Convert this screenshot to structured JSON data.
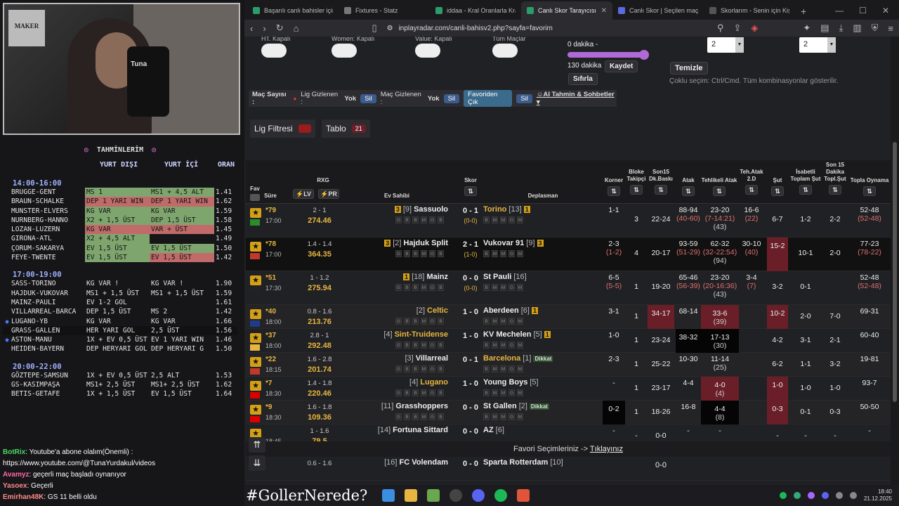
{
  "webcam": {
    "poster_text": "MAKER",
    "chair_text": "Tuna"
  },
  "picks": {
    "title": "TAHMİNLERİM",
    "col_abroad": "YURT DIŞI",
    "col_domestic": "YURT İÇİ",
    "col_odds": "ORAN",
    "groups": [
      {
        "time": "14:00-16:00",
        "rows": [
          {
            "m": "BRUGGE-GENT",
            "p1": "MS 1",
            "p2": "MS1 + 4,5 ALT",
            "o": "1.41",
            "c1": "g",
            "c2": "g",
            "dot": false
          },
          {
            "m": "BRAUN-SCHALKE",
            "p1": "DEP 1 YARI WIN",
            "p2": "DEP 1 YARI WIN",
            "o": "1.62",
            "c1": "r",
            "c2": "r",
            "dot": false
          },
          {
            "m": "MUNSTER-ELVERS",
            "p1": "KG VAR",
            "p2": "KG VAR",
            "o": "1.59",
            "c1": "g",
            "c2": "g",
            "dot": false
          },
          {
            "m": "NURNBERG-HANNO",
            "p1": "X2 + 1,5 ÜST",
            "p2": "DEP 1,5 ÜST",
            "o": "1.58",
            "c1": "g",
            "c2": "g",
            "dot": false
          },
          {
            "m": "LOZAN-LUZERN",
            "p1": "KG VAR",
            "p2": "VAR + ÜST",
            "o": "1.45",
            "c1": "r",
            "c2": "r",
            "dot": false
          },
          {
            "m": "GIRONA-ATL",
            "p1": "X2 + 4,5 ALT",
            "p2": "",
            "o": "1.49",
            "c1": "g",
            "c2": "n",
            "dot": false
          },
          {
            "m": "ÇORUM-SAKARYA",
            "p1": "EV 1,5 ÜST",
            "p2": "EV 1,5 ÜST",
            "o": "1.50",
            "c1": "g",
            "c2": "g",
            "dot": false
          },
          {
            "m": "FEYE-TWENTE",
            "p1": "EV 1,5 ÜST",
            "p2": "EV 1,5 ÜST",
            "o": "1.42",
            "c1": "g",
            "c2": "r",
            "dot": false
          }
        ]
      },
      {
        "time": "17:00-19:00",
        "rows": [
          {
            "m": "SASS-TORINO",
            "p1": "KG VAR  !",
            "p2": "KG VAR  !",
            "o": "1.90",
            "c1": "n",
            "c2": "n",
            "dot": false
          },
          {
            "m": "HAJDUK-VUKOVAR",
            "p1": "MS1 + 1,5 ÜST",
            "p2": "MS1 + 1,5 ÜST",
            "o": "1.59",
            "c1": "n",
            "c2": "n",
            "dot": false
          },
          {
            "m": "MAINZ-PAULI",
            "p1": "EV 1-2 GOL",
            "p2": "",
            "o": "1.61",
            "c1": "n",
            "c2": "n",
            "dot": false
          },
          {
            "m": "VILLARREAL-BARCA",
            "p1": "DEP 1,5 ÜST",
            "p2": "MS 2",
            "o": "1.42",
            "c1": "n",
            "c2": "n",
            "dot": false
          },
          {
            "m": "LUGANO-YB",
            "p1": "KG VAR",
            "p2": "KG VAR",
            "o": "1.66",
            "c1": "n",
            "c2": "n",
            "dot": true
          },
          {
            "m": "GRASS-GALLEN",
            "p1": "HER YARI GOL",
            "p2": "2,5 ÜST",
            "o": "1.56",
            "c1": "n",
            "c2": "n",
            "dot": false,
            "hl": true
          },
          {
            "m": "ASTON-MANU",
            "p1": "1X + EV 0,5 ÜST",
            "p2": "EV 1 YARI WIN",
            "o": "1.46",
            "c1": "n",
            "c2": "n",
            "dot": true
          },
          {
            "m": "HEIDEN-BAYERN",
            "p1": "DEP HERYARI GOL",
            "p2": "DEP HERYARI G",
            "o": "1.50",
            "c1": "n",
            "c2": "n",
            "dot": false
          }
        ]
      },
      {
        "time": "20:00-22:00",
        "rows": [
          {
            "m": "GÖZTEPE-SAMSUN",
            "p1": "1X + EV 0,5 ÜST",
            "p2": "2,5 ALT",
            "o": "1.53",
            "c1": "n",
            "c2": "n",
            "dot": false
          },
          {
            "m": "GS-KASIMPAŞA",
            "p1": "MS1+ 2,5 ÜST",
            "p2": "MS1+ 2,5 ÜST",
            "o": "1.62",
            "c1": "n",
            "c2": "n",
            "dot": false
          },
          {
            "m": "BETIS-GETAFE",
            "p1": "1X + 1,5 ÜST",
            "p2": "EV 1,5 ÜST",
            "o": "1.64",
            "c1": "n",
            "c2": "n",
            "dot": false
          }
        ]
      }
    ]
  },
  "chat": [
    {
      "name": "BotRix",
      "text": ": Youtube'a abone olalım(Önemli) :",
      "cls": "nm1"
    },
    {
      "name": "",
      "text": "https://www.youtube.com/@TunaYurdakul/videos",
      "cls": ""
    },
    {
      "name": "Avamyz",
      "text": ": geçerli maç başladı oynanıyor",
      "cls": "nm2"
    },
    {
      "name": "Yasoex",
      "text": ": Geçerli",
      "cls": "nm3"
    },
    {
      "name": "Emirhan48K",
      "text": ": GS 11 belli oldu",
      "cls": "nm3"
    }
  ],
  "browser": {
    "tabs": [
      {
        "label": "Başarılı canlı bahisler için Oy",
        "active": false,
        "color": "#2a9d6a"
      },
      {
        "label": "Fixtures - Statz",
        "active": false,
        "color": "#777"
      },
      {
        "label": "iddaa - Kral Oranlarla Kralı",
        "active": false,
        "color": "#2a9d6a"
      },
      {
        "label": "Canlı Skor Tarayıcısı ve",
        "active": true,
        "color": "#2a9d6a"
      },
      {
        "label": "Canlı Skor | Seçilen maçlar",
        "active": false,
        "color": "#5a6adf"
      },
      {
        "label": "Skorlarım - Senin için Kişise",
        "active": false,
        "color": "#555"
      }
    ],
    "url": "inplayradar.com/canli-bahisv2.php?sayfa=favorim"
  },
  "controls": {
    "toggle_labels": [
      "HT. Kapalı",
      "Women: Kapalı",
      "Value: Kapalı",
      "Tüm Maçlar"
    ],
    "slider_min": "0 dakika -",
    "slider_max": "130 dakika",
    "save": "Kaydet",
    "reset": "Sıfırla",
    "clear": "Temizle",
    "select_a": "2",
    "select_b": "2",
    "hint": "Çoklu seçim: Ctrl/Cmd. Tüm kombinasyonlar gösterilir.",
    "info_count": "Maç Sayısı :",
    "info_lig_hidden": "Lig Gizlenen :",
    "info_lig_val": "Yok",
    "info_mac_hidden": "Maç Gizlenen :",
    "info_mac_val": "Yok",
    "sil": "Sil",
    "fav_out": "Favoriden Çık",
    "ai": "AI Tahmin & Sohbetler",
    "lig_filter": "Lig Filtresi",
    "tablo": "Tablo",
    "tablo_count": "21"
  },
  "table": {
    "headers": {
      "fav": "Fav",
      "sure": "Süre",
      "rxg": "RXG",
      "lv": "LV",
      "pr": "PR",
      "home": "Ev Sahibi",
      "score": "Skor",
      "away": "Deplasman",
      "korner": "Korner",
      "bloke": "Bloke Takipçi",
      "son15": "Son15 Dk.Baskı",
      "atak": "Atak",
      "tehlikeli": "Tehlikeli Atak",
      "tehatak": "Teh.Atak 2.D",
      "sut": "Şut",
      "isabetli": "İsabetli Toplam Şut",
      "son15sut": "Son 15 Dakika Topl.Şut",
      "topla": "Topla Oynama"
    },
    "rows": [
      {
        "min": "79",
        "start": "17:00",
        "xg": "2 - 1",
        "xgv": "274.46",
        "home": "Sassuolo",
        "hrank": "[9]",
        "hbadge": "3",
        "score": "0 - 1",
        "ht": "(0-0)",
        "away": "Torino",
        "arank": "[13]",
        "abadge": "1",
        "awayColor": "#e8b640",
        "korner": "1-1",
        "bloke": "3",
        "son15": "22-24",
        "atak": "88-94",
        "atak2": "(40-60)",
        "teh": "23-20",
        "teh2": "(7-14:21)",
        "teh3": "(43)",
        "teh2d": "16-6",
        "teh2d2": "(22)",
        "sut": "6-7",
        "isab": "1-2",
        "s15": "2-2",
        "top": "52-48",
        "top2": "(52-48)",
        "style": ""
      },
      {
        "min": "78",
        "start": "17:00",
        "xg": "1.4 - 1.4",
        "xgv": "364.35",
        "home": "Hajduk Split",
        "hrank": "[2]",
        "hbadge": "3",
        "score": "2 - 1",
        "ht": "(1-0)",
        "away": "Vukovar 91",
        "arank": "[9]",
        "abadge": "3",
        "awayColor": "#eee",
        "korner": "2-3",
        "korner2": "(1-2)",
        "bloke": "4",
        "son15": "20-17",
        "atak": "93-59",
        "atak2": "(51-29)",
        "teh": "62-32",
        "teh2": "(32-22:54)",
        "teh3": "(94)",
        "teh2d": "30-10",
        "teh2d2": "(40)",
        "sut": "15-2",
        "isab": "10-1",
        "s15": "2-0",
        "top": "77-23",
        "top2": "(78-22)",
        "style": "dark",
        "sutHot": true
      },
      {
        "min": "51",
        "start": "17:30",
        "xg": "1 - 1.2",
        "xgv": "275.94",
        "home": "Mainz",
        "hrank": "[18]",
        "hbadge": "1",
        "score": "0 - 0",
        "ht": "(0-0)",
        "away": "St Pauli",
        "arank": "[16]",
        "abadge": "",
        "awayColor": "#eee",
        "korner": "6-5",
        "korner2": "(5-5)",
        "bloke": "1",
        "son15": "19-20",
        "atak": "65-46",
        "atak2": "(56-39)",
        "teh": "23-20",
        "teh2": "(20-16:36)",
        "teh3": "(43)",
        "teh2d": "3-4",
        "teh2d2": "(7)",
        "sut": "3-2",
        "isab": "0-1",
        "s15": "",
        "top": "52-48",
        "top2": "(52-48)",
        "style": ""
      },
      {
        "min": "40",
        "start": "18:00",
        "xg": "0.8 - 1.6",
        "xgv": "213.76",
        "home": "Celtic",
        "hrank": "[2]",
        "hbadge": "",
        "score": "1 - 0",
        "ht": "",
        "away": "Aberdeen",
        "arank": "[6]",
        "abadge": "1",
        "awayColor": "#eee",
        "homeColor": "#e8b640",
        "korner": "3-1",
        "bloke": "1",
        "son15": "34-17",
        "son15Hot": true,
        "atak": "68-14",
        "teh": "33-6",
        "teh3": "(39)",
        "tehHot": true,
        "teh2d": "",
        "sut": "10-2",
        "sutHot": true,
        "isab": "2-0",
        "s15": "7-0",
        "top": "69-31",
        "style": "alt"
      },
      {
        "min": "37",
        "start": "18:00",
        "xg": "2.8 - 1",
        "xgv": "292.48",
        "home": "Sint-Truidense",
        "hrank": "[4]",
        "hbadge": "",
        "score": "1 - 0",
        "ht": "",
        "away": "KV Mechelen",
        "arank": "[5]",
        "abadge": "1",
        "awayColor": "#eee",
        "homeColor": "#e8b640",
        "korner": "1-0",
        "bloke": "1",
        "son15": "23-24",
        "atak": "38-32",
        "atakBlack": true,
        "teh": "17-13",
        "teh3": "(30)",
        "tehBlack": true,
        "teh2d": "",
        "sut": "4-2",
        "isab": "3-1",
        "s15": "2-1",
        "top": "60-40",
        "style": ""
      },
      {
        "min": "22",
        "start": "18:15",
        "xg": "1.6 - 2.8",
        "xgv": "201.74",
        "home": "Villarreal",
        "hrank": "[3]",
        "hbadge": "",
        "score": "0 - 1",
        "ht": "",
        "away": "Barcelona",
        "arank": "[1]",
        "abadge": "Dikkat",
        "awayColor": "#e8b640",
        "korner": "2-3",
        "bloke": "1",
        "son15": "25-22",
        "atak": "10-30",
        "teh": "11-14",
        "teh3": "(25)",
        "teh2d": "",
        "sut": "6-2",
        "isab": "1-1",
        "s15": "3-2",
        "top": "19-81",
        "style": "alt"
      },
      {
        "min": "7",
        "start": "18:30",
        "xg": "1.4 - 1.8",
        "xgv": "220.46",
        "home": "Lugano",
        "hrank": "[4]",
        "hbadge": "",
        "score": "1 - 0",
        "ht": "",
        "away": "Young Boys",
        "arank": "[5]",
        "abadge": "",
        "awayColor": "#eee",
        "homeColor": "#e8b640",
        "korner": "-",
        "bloke": "1",
        "son15": "23-17",
        "atak": "4-4",
        "teh": "4-0",
        "teh3": "(4)",
        "tehHot": true,
        "teh2d": "",
        "sut": "1-0",
        "sutHot": true,
        "isab": "1-0",
        "s15": "1-0",
        "top": "93-7",
        "style": ""
      },
      {
        "min": "9",
        "start": "18:30",
        "xg": "1.6 - 1.8",
        "xgv": "109.36",
        "home": "Grasshoppers",
        "hrank": "[11]",
        "hbadge": "",
        "score": "0 - 0",
        "ht": "",
        "away": "St Gallen",
        "arank": "[2]",
        "abadge": "Dikkat",
        "awayColor": "#eee",
        "korner": "0-2",
        "kornerBlack": true,
        "bloke": "1",
        "son15": "18-26",
        "atak": "16-8",
        "teh": "4-4",
        "teh3": "(8)",
        "tehBlack": true,
        "teh2d": "",
        "sut": "0-3",
        "sutHot": true,
        "isab": "0-1",
        "s15": "0-3",
        "top": "50-50",
        "style": "alt"
      },
      {
        "min": "",
        "start": "18:45",
        "xg": "1 - 1.6",
        "xgv": "79.5",
        "home": "Fortuna Sittard",
        "hrank": "[14]",
        "hbadge": "",
        "score": "0 - 0",
        "ht": "",
        "away": "AZ",
        "arank": "[6]",
        "abadge": "",
        "awayColor": "#eee",
        "korner": "-",
        "bloke": "-",
        "son15": "0-0",
        "atak": "-",
        "teh": "-",
        "teh2d": "",
        "sut": "-",
        "isab": "-",
        "s15": "-",
        "top": "-",
        "style": ""
      }
    ],
    "fav_text": "Favori Seçimleriniz ->",
    "fav_link": "Tıklayınız",
    "last": {
      "xg": "0.6 - 1.6",
      "home": "FC Volendam",
      "hrank": "[16]",
      "score": "0 - 0",
      "away": "Sparta Rotterdam",
      "arank": "[10]",
      "son15": "0-0"
    }
  },
  "taskbar": {
    "hashtag": "#GollerNerede?",
    "time": "18:40",
    "date": "21.12.2025"
  }
}
